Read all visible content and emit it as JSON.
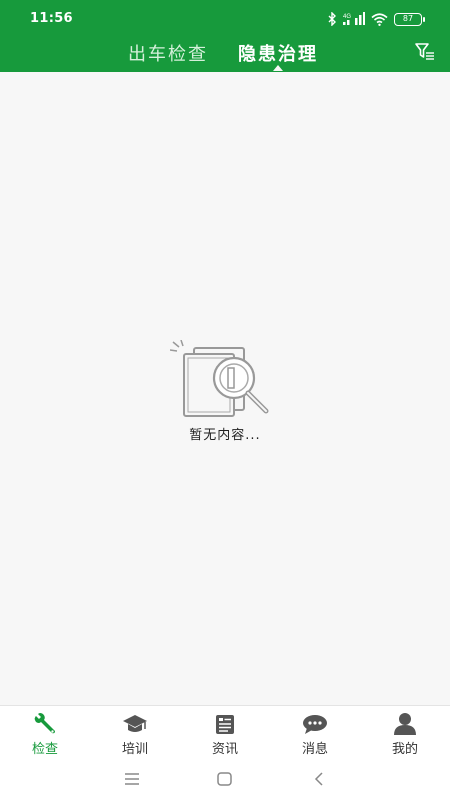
{
  "status_bar": {
    "time": "11:56",
    "network_label": "4G",
    "battery": "87",
    "icons": [
      "bluetooth-icon",
      "signal-icon",
      "wifi-icon",
      "battery-icon"
    ]
  },
  "header": {
    "tabs": [
      {
        "label": "出车检查",
        "active": false
      },
      {
        "label": "隐患治理",
        "active": true
      }
    ],
    "filter_icon": "filter-icon",
    "background_color": "#179a3c"
  },
  "content": {
    "empty_icon": "search-document-icon",
    "empty_message": "暂无内容..."
  },
  "bottom_nav": {
    "items": [
      {
        "label": "检查",
        "icon": "wrench-icon",
        "active": true
      },
      {
        "label": "培训",
        "icon": "graduation-cap-icon",
        "active": false
      },
      {
        "label": "资讯",
        "icon": "news-icon",
        "active": false
      },
      {
        "label": "消息",
        "icon": "chat-icon",
        "active": false
      },
      {
        "label": "我的",
        "icon": "user-icon",
        "active": false
      }
    ],
    "active_color": "#179a3c",
    "inactive_icon_color": "#555555"
  },
  "system_nav": {
    "buttons": [
      "menu-icon",
      "home-icon",
      "back-icon"
    ]
  }
}
